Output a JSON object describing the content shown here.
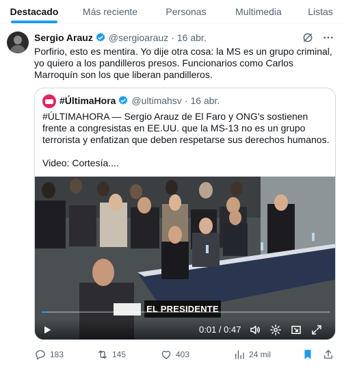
{
  "tabs": [
    {
      "label": "Destacado",
      "active": true
    },
    {
      "label": "Más reciente",
      "active": false
    },
    {
      "label": "Personas",
      "active": false
    },
    {
      "label": "Multimedia",
      "active": false
    },
    {
      "label": "Listas",
      "active": false
    }
  ],
  "tweet": {
    "author_name": "Sergio Arauz",
    "handle": "@sergioarauz",
    "separator": "·",
    "date": "16 abr.",
    "text": "Porfirio, esto es mentira. Yo dije otra cosa: la MS es un grupo criminal, yo quiero a los pandilleros presos. Funcionarios como Carlos Marroquín son los que liberan pandilleros.",
    "verified": true
  },
  "quote": {
    "author_name": "#ÚltimaHora",
    "handle": "@ultimahsv",
    "separator": "·",
    "date": "16 abr.",
    "text": "#ÚLTIMAHORA — Sergio Arauz de El Faro y ONG's sostienen frente a congresistas en EE.UU. que la MS-13 no es un grupo terrorista y enfatizan que deben respetarse sus derechos humanos.\n\nVideo: Cortesía....",
    "verified": true
  },
  "video": {
    "caption": "EL PRESIDENTE",
    "time": "0:01 / 0:47",
    "progress_fraction": 0.02
  },
  "actions": {
    "replies": "183",
    "reposts": "145",
    "likes": "403",
    "views": "24 mil"
  },
  "colors": {
    "accent": "#1d9bf0",
    "text_primary": "#0f1419",
    "text_secondary": "#536471",
    "border": "#cfd9de"
  },
  "icons": {
    "grok": "grok-icon",
    "more": "more-dots-icon",
    "reply": "reply-icon",
    "repost": "repost-icon",
    "like": "heart-icon",
    "views": "views-icon",
    "bookmark": "bookmark-icon",
    "share": "share-icon"
  }
}
